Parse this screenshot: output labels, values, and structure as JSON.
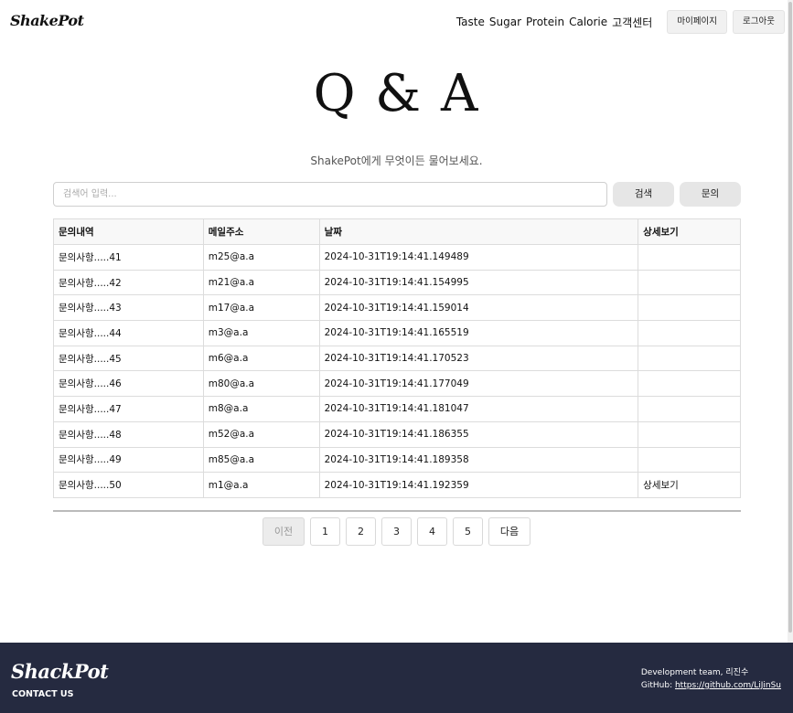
{
  "header": {
    "logo": "ShakePot",
    "nav": [
      "Taste",
      "Sugar",
      "Protein",
      "Calorie",
      "고객센터"
    ],
    "mypage_label": "마이페이지",
    "logout_label": "로그아웃"
  },
  "page": {
    "title": "Q & A",
    "subtitle": "ShakePot에게 무엇이든 물어보세요."
  },
  "search": {
    "placeholder": "검색어 입력...",
    "search_label": "검색",
    "ask_label": "문의"
  },
  "table": {
    "headers": [
      "문의내역",
      "메일주소",
      "날짜",
      "상세보기"
    ],
    "rows": [
      {
        "title": "문의사항.....41",
        "email": "m25@a.a",
        "date": "2024-10-31T19:14:41.149489",
        "detail": ""
      },
      {
        "title": "문의사항.....42",
        "email": "m21@a.a",
        "date": "2024-10-31T19:14:41.154995",
        "detail": ""
      },
      {
        "title": "문의사항.....43",
        "email": "m17@a.a",
        "date": "2024-10-31T19:14:41.159014",
        "detail": ""
      },
      {
        "title": "문의사항.....44",
        "email": "m3@a.a",
        "date": "2024-10-31T19:14:41.165519",
        "detail": ""
      },
      {
        "title": "문의사항.....45",
        "email": "m6@a.a",
        "date": "2024-10-31T19:14:41.170523",
        "detail": ""
      },
      {
        "title": "문의사항.....46",
        "email": "m80@a.a",
        "date": "2024-10-31T19:14:41.177049",
        "detail": ""
      },
      {
        "title": "문의사항.....47",
        "email": "m8@a.a",
        "date": "2024-10-31T19:14:41.181047",
        "detail": ""
      },
      {
        "title": "문의사항.....48",
        "email": "m52@a.a",
        "date": "2024-10-31T19:14:41.186355",
        "detail": ""
      },
      {
        "title": "문의사항.....49",
        "email": "m85@a.a",
        "date": "2024-10-31T19:14:41.189358",
        "detail": ""
      },
      {
        "title": "문의사항.....50",
        "email": "m1@a.a",
        "date": "2024-10-31T19:14:41.192359",
        "detail": "상세보기"
      }
    ]
  },
  "pagination": {
    "prev_label": "이전",
    "pages": [
      "1",
      "2",
      "3",
      "4",
      "5"
    ],
    "next_label": "다음"
  },
  "footer": {
    "logo": "ShackPot",
    "contact": "CONTACT US",
    "team": "Development team, 리진수",
    "github_prefix": "GitHub: ",
    "github_link": "https://github.com/LiJinSu"
  },
  "colors": {
    "footer_bg": "#252a40",
    "button_bg": "#e6e6e6"
  }
}
